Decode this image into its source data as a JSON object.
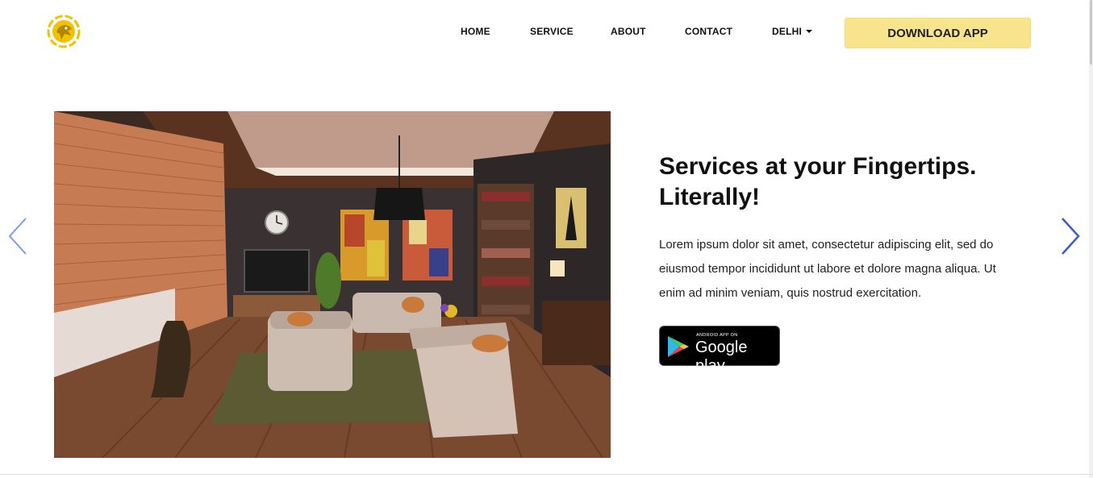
{
  "nav": {
    "items": [
      {
        "label": "HOME"
      },
      {
        "label": "SERVICE"
      },
      {
        "label": "ABOUT"
      },
      {
        "label": "CONTACT"
      },
      {
        "label": "DELHI"
      }
    ],
    "download_label": "DOWNLOAD APP"
  },
  "hero": {
    "headline": "Services at your Fingertips. Literally!",
    "body": "Lorem ipsum dolor sit amet, consectetur adipiscing elit, sed do eiusmod tempor incididunt ut labore et dolore magna aliqua. Ut enim ad minim veniam, quis nostrud exercitation.",
    "image_icon": "living-room-photo",
    "store_badge": {
      "small": "ANDROID APP ON",
      "big": "Google play"
    }
  },
  "carousel": {
    "prev_icon": "chevron-left-icon",
    "next_icon": "chevron-right-icon"
  },
  "colors": {
    "accent": "#f7e48c",
    "logo": "#f2c200",
    "arrows": "#3a5bd0"
  }
}
